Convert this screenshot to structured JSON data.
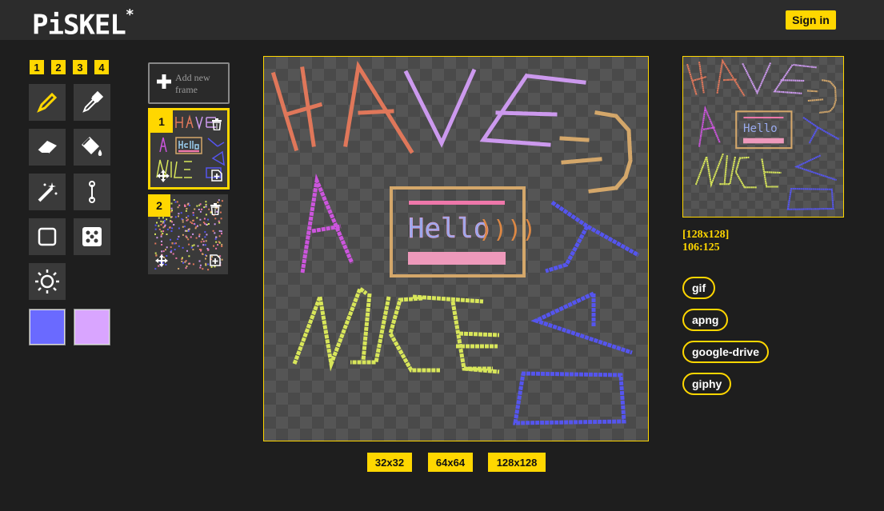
{
  "app": {
    "logo_text": "PiSKEL",
    "logo_mark": "*",
    "signin_label": "Sign in"
  },
  "tools": {
    "pen_sizes": [
      "1",
      "2",
      "3",
      "4"
    ],
    "items": [
      {
        "name": "pen-tool-icon"
      },
      {
        "name": "eyedropper-tool-icon"
      },
      {
        "name": "eraser-tool-icon"
      },
      {
        "name": "paint-bucket-tool-icon"
      },
      {
        "name": "magic-wand-tool-icon"
      },
      {
        "name": "stroke-tool-icon"
      },
      {
        "name": "rectangle-tool-icon"
      },
      {
        "name": "dither-tool-icon"
      },
      {
        "name": "lighten-tool-icon"
      }
    ],
    "primary_color": "#6a6aff",
    "secondary_color": "#d9a5ff"
  },
  "frames": {
    "add_label": "Add new frame",
    "items": [
      {
        "number": "1",
        "selected": true
      },
      {
        "number": "2",
        "selected": false
      }
    ]
  },
  "canvas": {
    "lines": [
      "HAVE",
      "A",
      "NICE",
      "DAY"
    ],
    "box_text": "Hello",
    "box_suffix": "))))"
  },
  "preview": {
    "size_label": "[128x128]",
    "cursor_label": "106:125"
  },
  "export": [
    "gif",
    "apng",
    "google-drive",
    "giphy"
  ],
  "resize": [
    "32x32",
    "64x64",
    "128x128"
  ],
  "colors": {
    "accent": "#ffd700",
    "have": "#e0775a",
    "have_ve": "#cc99ee",
    "a": "#cc55dd",
    "nice": "#d8e65a",
    "day": "#5555ee",
    "box_border": "#d4a76a"
  }
}
